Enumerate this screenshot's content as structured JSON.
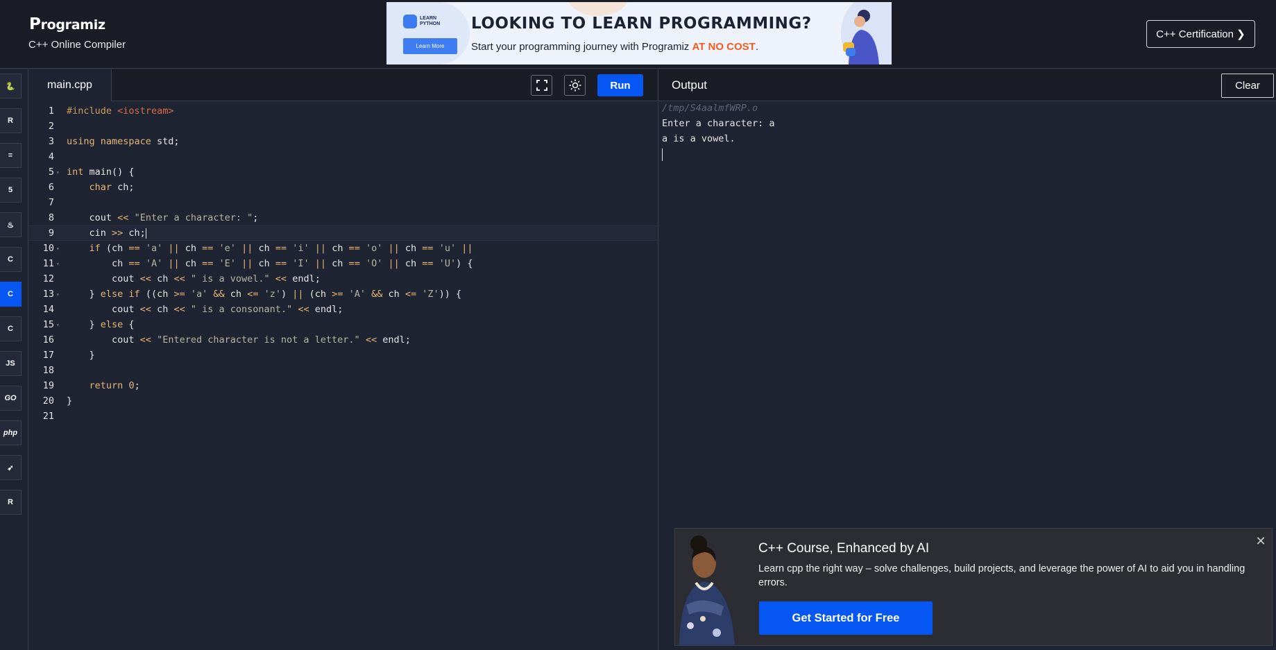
{
  "header": {
    "logo_first": "P",
    "logo_rest": "rogramiz",
    "subtitle": "C++ Online Compiler",
    "cert_button": "C++ Certification ❯"
  },
  "banner": {
    "logo_text": "LEARN PYTHON",
    "learn_more": "Learn More",
    "title": "LOOKING TO LEARN PROGRAMMING?",
    "sub_prefix": "Start your programming journey with Programiz ",
    "sub_accent": "AT NO COST",
    "sub_suffix": "."
  },
  "sidebar": {
    "languages": [
      {
        "name": "python",
        "glyph": "🐍",
        "active": false
      },
      {
        "name": "r",
        "glyph": "R",
        "active": false
      },
      {
        "name": "sql",
        "glyph": "≡",
        "active": false
      },
      {
        "name": "html",
        "glyph": "5",
        "active": false
      },
      {
        "name": "java",
        "glyph": "♨",
        "active": false
      },
      {
        "name": "c",
        "glyph": "C",
        "active": false
      },
      {
        "name": "cpp",
        "glyph": "C",
        "active": true
      },
      {
        "name": "csharp",
        "glyph": "C",
        "active": false
      },
      {
        "name": "javascript",
        "glyph": "JS",
        "active": false
      },
      {
        "name": "go",
        "glyph": "GO",
        "active": false
      },
      {
        "name": "php",
        "glyph": "php",
        "active": false
      },
      {
        "name": "swift",
        "glyph": "➶",
        "active": false
      },
      {
        "name": "rust",
        "glyph": "R",
        "active": false
      }
    ]
  },
  "editor": {
    "file_tab": "main.cpp",
    "run_label": "Run",
    "current_line": 9,
    "lines": [
      {
        "n": "1",
        "fold": false,
        "html": "<span class=\"pp\">#include</span> <span class=\"inc\">&lt;iostream&gt;</span>"
      },
      {
        "n": "2",
        "fold": false,
        "html": ""
      },
      {
        "n": "3",
        "fold": false,
        "html": "<span class=\"kw\">using namespace</span> std;"
      },
      {
        "n": "4",
        "fold": false,
        "html": ""
      },
      {
        "n": "5",
        "fold": true,
        "html": "<span class=\"kw\">int</span> main() {"
      },
      {
        "n": "6",
        "fold": false,
        "html": "    <span class=\"kw\">char</span> ch;"
      },
      {
        "n": "7",
        "fold": false,
        "html": ""
      },
      {
        "n": "8",
        "fold": false,
        "html": "    cout <span class=\"op\">&lt;&lt;</span> <span class=\"str\">\"Enter a character: \"</span>;"
      },
      {
        "n": "9",
        "fold": false,
        "html": "    cin <span class=\"op\">&gt;&gt;</span> ch;<span class=\"cursor-caret\"></span>"
      },
      {
        "n": "10",
        "fold": true,
        "html": "    <span class=\"kw\">if</span> (ch <span class=\"op\">==</span> <span class=\"str\">'a'</span> <span class=\"op\">||</span> ch <span class=\"op\">==</span> <span class=\"str\">'e'</span> <span class=\"op\">||</span> ch <span class=\"op\">==</span> <span class=\"str\">'i'</span> <span class=\"op\">||</span> ch <span class=\"op\">==</span> <span class=\"str\">'o'</span> <span class=\"op\">||</span> ch <span class=\"op\">==</span> <span class=\"str\">'u'</span> <span class=\"op\">||</span>"
      },
      {
        "n": "11",
        "fold": true,
        "html": "        ch <span class=\"op\">==</span> <span class=\"str\">'A'</span> <span class=\"op\">||</span> ch <span class=\"op\">==</span> <span class=\"str\">'E'</span> <span class=\"op\">||</span> ch <span class=\"op\">==</span> <span class=\"str\">'I'</span> <span class=\"op\">||</span> ch <span class=\"op\">==</span> <span class=\"str\">'O'</span> <span class=\"op\">||</span> ch <span class=\"op\">==</span> <span class=\"str\">'U'</span>) {"
      },
      {
        "n": "12",
        "fold": false,
        "html": "        cout <span class=\"op\">&lt;&lt;</span> ch <span class=\"op\">&lt;&lt;</span> <span class=\"str\">\" is a vowel.\"</span> <span class=\"op\">&lt;&lt;</span> endl;"
      },
      {
        "n": "13",
        "fold": true,
        "html": "    } <span class=\"kw\">else if</span> ((ch <span class=\"op\">&gt;=</span> <span class=\"str\">'a'</span> <span class=\"op\">&amp;&amp;</span> ch <span class=\"op\">&lt;=</span> <span class=\"str\">'z'</span>) <span class=\"op\">||</span> (ch <span class=\"op\">&gt;=</span> <span class=\"str\">'A'</span> <span class=\"op\">&amp;&amp;</span> ch <span class=\"op\">&lt;=</span> <span class=\"str\">'Z'</span>)) {"
      },
      {
        "n": "14",
        "fold": false,
        "html": "        cout <span class=\"op\">&lt;&lt;</span> ch <span class=\"op\">&lt;&lt;</span> <span class=\"str\">\" is a consonant.\"</span> <span class=\"op\">&lt;&lt;</span> endl;"
      },
      {
        "n": "15",
        "fold": true,
        "html": "    } <span class=\"kw\">else</span> {"
      },
      {
        "n": "16",
        "fold": false,
        "html": "        cout <span class=\"op\">&lt;&lt;</span> <span class=\"str\">\"Entered character is not a letter.\"</span> <span class=\"op\">&lt;&lt;</span> endl;"
      },
      {
        "n": "17",
        "fold": false,
        "html": "    }"
      },
      {
        "n": "18",
        "fold": false,
        "html": ""
      },
      {
        "n": "19",
        "fold": false,
        "html": "    <span class=\"kw\">return</span> <span class=\"num\">0</span>;"
      },
      {
        "n": "20",
        "fold": false,
        "html": "}"
      },
      {
        "n": "21",
        "fold": false,
        "html": ""
      }
    ]
  },
  "output": {
    "title": "Output",
    "clear_label": "Clear",
    "path": "/tmp/S4aalmfWRP.o",
    "lines": [
      "Enter a character: a",
      "a is a vowel."
    ]
  },
  "promo": {
    "title": "C++ Course, Enhanced by AI",
    "text": "Learn cpp the right way – solve challenges, build projects, and leverage the power of AI to aid you in handling errors.",
    "cta": "Get Started for Free",
    "close": "✕"
  },
  "colors": {
    "accent": "#0556f3",
    "background": "#1f2433",
    "header": "#1a1d26",
    "banner_accent": "#f25c21"
  }
}
